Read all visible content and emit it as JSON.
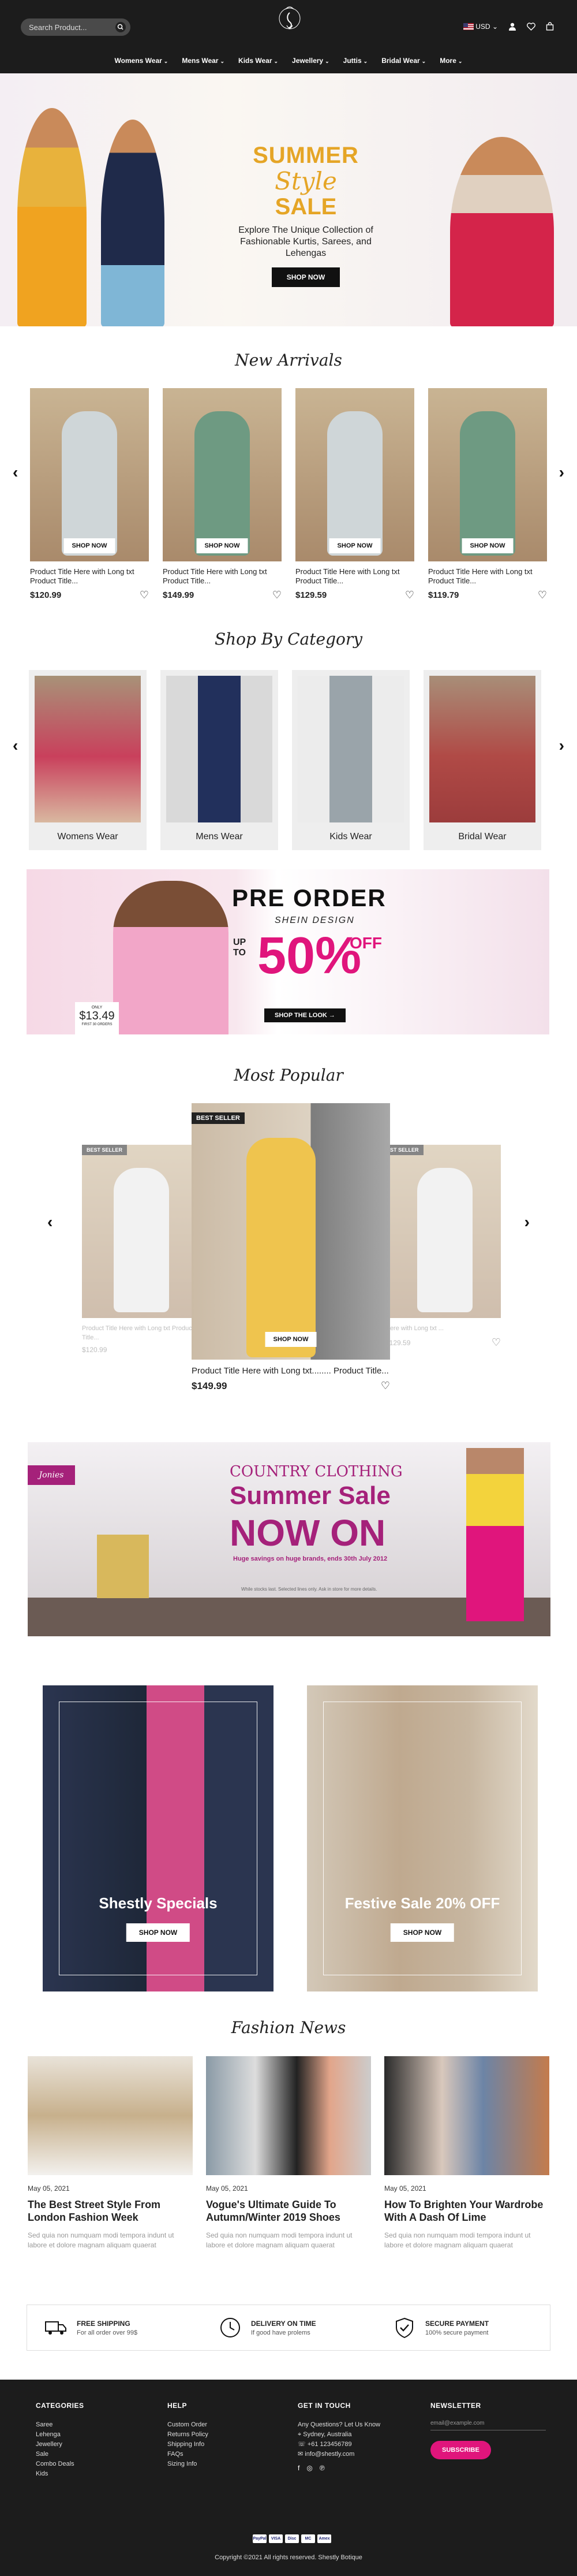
{
  "header": {
    "search_placeholder": "Search Product...",
    "currency": "USD",
    "currency_chevron": "⌄",
    "nav": [
      {
        "label": "Womens Wear"
      },
      {
        "label": "Mens Wear"
      },
      {
        "label": "Kids Wear"
      },
      {
        "label": "Jewellery"
      },
      {
        "label": "Juttis"
      },
      {
        "label": "Bridal Wear"
      },
      {
        "label": "More"
      }
    ]
  },
  "hero": {
    "line1": "SUMMER",
    "line2": "Style",
    "line3": "SALE",
    "subtitle": "Explore The Unique Collection of Fashionable Kurtis, Sarees, and Lehengas",
    "button": "SHOP NOW"
  },
  "new_arrivals": {
    "title": "New Arrivals",
    "products": [
      {
        "title": "Product Title Here with Long txt Product Title...",
        "price": "$120.99",
        "button": "SHOP NOW"
      },
      {
        "title": "Product Title Here with Long txt Product Title...",
        "price": "$149.99",
        "button": "SHOP NOW"
      },
      {
        "title": "Product Title Here with Long txt Product Title...",
        "price": "$129.59",
        "button": "SHOP NOW"
      },
      {
        "title": "Product Title Here with Long txt Product Title...",
        "price": "$119.79",
        "button": "SHOP NOW"
      }
    ]
  },
  "categories": {
    "title": "Shop By Category",
    "items": [
      {
        "label": "Womens Wear"
      },
      {
        "label": "Mens Wear"
      },
      {
        "label": "Kids Wear"
      },
      {
        "label": "Bridal Wear"
      }
    ]
  },
  "preorder": {
    "title": "PRE ORDER",
    "subtitle": "SHEIN DESIGN",
    "up_to": "UP TO",
    "percent": "50%",
    "off": "OFF",
    "button": "SHOP THE LOOK",
    "price": "$13.49",
    "price_top": "ONLY",
    "price_note": "FIRST 30 ORDERS"
  },
  "most_popular": {
    "title": "Most Popular",
    "badge": "BEST SELLER",
    "side_badge_left": "BEST SELLER",
    "side_badge_right": "ST SELLER",
    "center": {
      "title": "Product Title Here with Long txt........ Product Title...",
      "price": "$149.99",
      "button": "SHOP NOW"
    },
    "left": {
      "title": "Product Title Here with Long txt Product Title...",
      "price": "$120.99"
    },
    "right": {
      "title": "Here with Long txt ...",
      "price": "$129.59"
    }
  },
  "country_banner": {
    "brand": "Jonies",
    "line1": "COUNTRY CLOTHING",
    "line2": "Summer Sale",
    "line3": "NOW ON",
    "line4": "Huge savings on huge brands, ends 30th July 2012",
    "fine": "While stocks last. Selected lines only. Ask in store for more details."
  },
  "promos": [
    {
      "title": "Shestly Specials",
      "button": "SHOP NOW"
    },
    {
      "title": "Festive Sale 20% OFF",
      "button": "SHOP NOW"
    }
  ],
  "news": {
    "title": "Fashion News",
    "items": [
      {
        "date": "May 05, 2021",
        "title": "The Best Street Style From London Fashion Week",
        "body": "Sed quia non numquam modi tempora indunt ut labore et dolore magnam aliquam quaerat"
      },
      {
        "date": "May 05, 2021",
        "title": "Vogue's Ultimate Guide To Autumn/Winter 2019 Shoes",
        "body": "Sed quia non numquam modi tempora indunt ut labore et dolore magnam aliquam quaerat"
      },
      {
        "date": "May 05, 2021",
        "title": "How To Brighten Your Wardrobe With A Dash Of Lime",
        "body": "Sed quia non numquam modi tempora indunt ut labore et dolore magnam aliquam quaerat"
      }
    ]
  },
  "features": [
    {
      "title": "FREE SHIPPING",
      "sub": "For all order over 99$",
      "icon": "truck-icon"
    },
    {
      "title": "DELIVERY ON TIME",
      "sub": "If good have prolems",
      "icon": "clock-icon"
    },
    {
      "title": "SECURE PAYMENT",
      "sub": "100% secure payment",
      "icon": "shield-check-icon"
    }
  ],
  "footer": {
    "categories_title": "CATEGORIES",
    "categories": [
      "Saree",
      "Lehenga",
      "Jewellery",
      "Sale",
      "Combo Deals",
      "Kids"
    ],
    "help_title": "HELP",
    "help": [
      "Custom Order",
      "Returns Policy",
      "Shipping Info",
      "FAQs",
      "Sizing Info"
    ],
    "contact_title": "GET IN TOUCH",
    "contact_intro": "Any Questions? Let Us Know",
    "address": "Sydney, Australia",
    "phone": "+61 123456789",
    "email": "info@shestly.com",
    "newsletter_title": "NEWSLETTER",
    "newsletter_placeholder": "email@example.com",
    "subscribe": "SUBSCRIBE",
    "payments": [
      "PayPal",
      "VISA",
      "Disc",
      "MC",
      "Amex"
    ],
    "copyright": "Copyright ©2021 All rights reserved. Shestly Botique"
  },
  "colors": {
    "accent": "#e0157c",
    "gold": "#e5a526",
    "dark": "#1c1c1c"
  }
}
